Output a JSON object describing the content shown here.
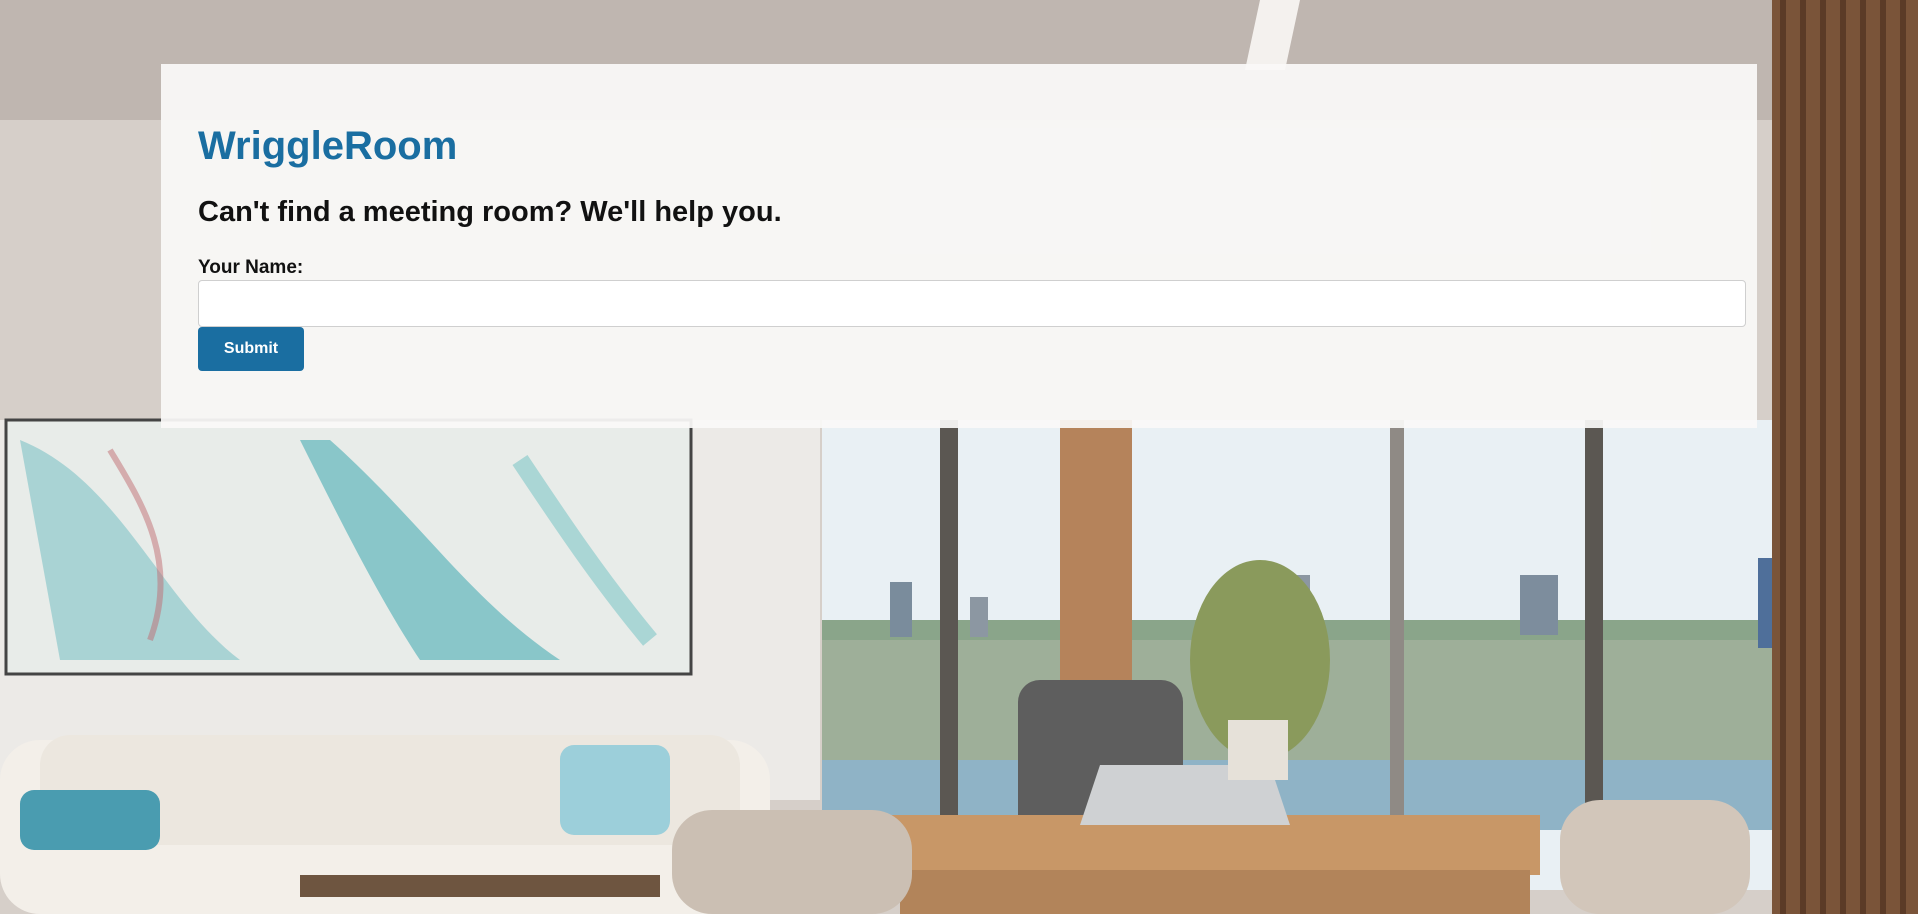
{
  "app": {
    "brand": "WriggleRoom",
    "headline": "Can't find a meeting room? We'll help you."
  },
  "form": {
    "name_label": "Your Name:",
    "name_value": "",
    "name_placeholder": "",
    "submit_label": "Submit"
  },
  "colors": {
    "accent": "#1a6ea1",
    "card_background": "#faf9f8",
    "heading_text": "#111111"
  },
  "background": {
    "scene": "office-interior-photo"
  }
}
